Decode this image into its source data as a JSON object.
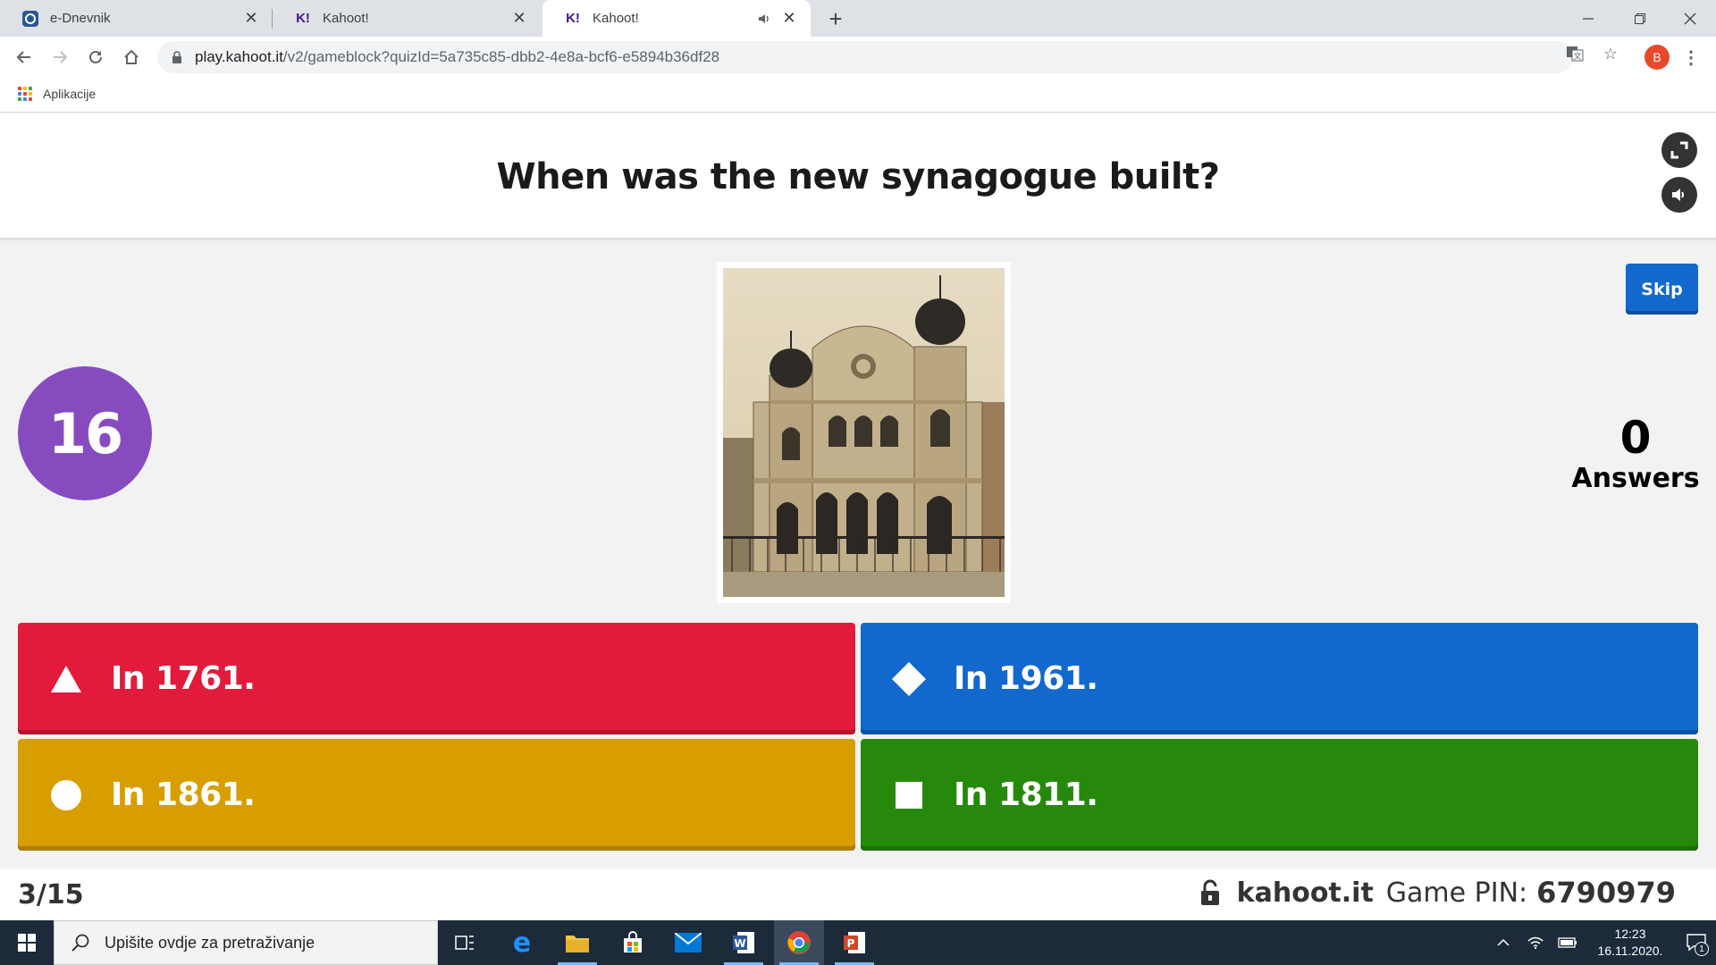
{
  "browser": {
    "tabs": [
      {
        "title": "e-Dnevnik",
        "favicon": "edn-icon"
      },
      {
        "title": "Kahoot!",
        "favicon": "K!"
      },
      {
        "title": "Kahoot!",
        "favicon": "K!",
        "active": true
      }
    ],
    "url_host": "play.kahoot.it",
    "url_path": "/v2/gameblock?quizId=5a735c85-dbb2-4e8a-bcf6-e5894b36df28",
    "profile_initial": "B",
    "bookmarks": {
      "apps_label": "Aplikacije"
    }
  },
  "game": {
    "question": "When was the new synagogue built?",
    "timer": "16",
    "skip_label": "Skip",
    "answers_count": "0",
    "answers_label": "Answers",
    "options": [
      {
        "text": "In 1761.",
        "shape": "triangle",
        "color": "#e21b3c"
      },
      {
        "text": "In 1961.",
        "shape": "diamond",
        "color": "#1368ce"
      },
      {
        "text": "In 1861.",
        "shape": "circle",
        "color": "#d89e00"
      },
      {
        "text": "In 1811.",
        "shape": "square",
        "color": "#26890c"
      }
    ],
    "progress": "3/15",
    "site": "kahoot.it",
    "pin_label": "Game PIN:",
    "pin": "6790979",
    "accent_purple": "#864cbf"
  },
  "taskbar": {
    "search_placeholder": "Upišite ovdje za pretraživanje",
    "time": "12:23",
    "date": "16.11.2020.",
    "notification_count": "1"
  }
}
